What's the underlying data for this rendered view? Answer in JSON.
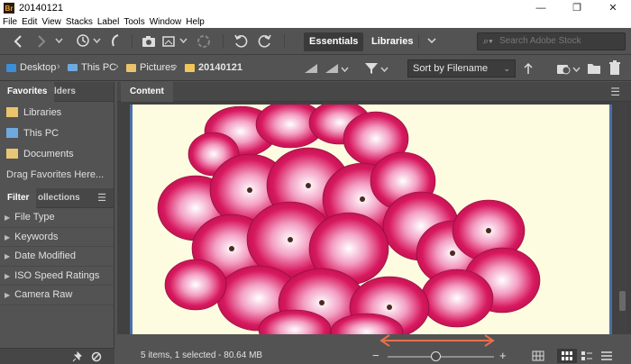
{
  "window": {
    "title": "20140121",
    "app_icon": "Br",
    "controls": {
      "minimize": "—",
      "maximize": "❐",
      "close": "✕"
    }
  },
  "menu": [
    "File",
    "Edit",
    "View",
    "Stacks",
    "Label",
    "Tools",
    "Window",
    "Help"
  ],
  "toolbar": {
    "workspaces": [
      "Essentials",
      "Libraries"
    ],
    "active_workspace": "Essentials",
    "search_placeholder": "Search Adobe Stock"
  },
  "breadcrumb": [
    {
      "label": "Desktop",
      "icon": "desktop-folder-icon"
    },
    {
      "label": "This PC",
      "icon": "computer-icon"
    },
    {
      "label": "Pictures",
      "icon": "pictures-folder-icon"
    },
    {
      "label": "20140121",
      "icon": "folder-icon"
    }
  ],
  "sort": {
    "selected": "Sort by Filename"
  },
  "left_panel": {
    "top_tabs": [
      "Favorites",
      "lders"
    ],
    "favorites": [
      {
        "label": "Libraries",
        "icon": "libraries-icon"
      },
      {
        "label": "This PC",
        "icon": "computer-icon"
      },
      {
        "label": "Documents",
        "icon": "documents-icon"
      }
    ],
    "drag_hint": "Drag Favorites Here...",
    "bottom_tabs": [
      "Filter",
      "ollections"
    ],
    "filters": [
      "File Type",
      "Keywords",
      "Date Modified",
      "ISO Speed Ratings",
      "Camera Raw"
    ]
  },
  "content": {
    "tab_label": "Content",
    "thumbnail_subject": "pink geranium flowers"
  },
  "status": {
    "summary": "5 items, 1 selected - 80.64 MB",
    "zoom_minus": "−",
    "zoom_plus": "+",
    "zoom_level": 0.45
  },
  "colors": {
    "panel_bg": "#535353",
    "accent_blue": "#4a6fa8",
    "annotation_arrow": "#e8704c",
    "flower_pink": "#d8195f"
  }
}
